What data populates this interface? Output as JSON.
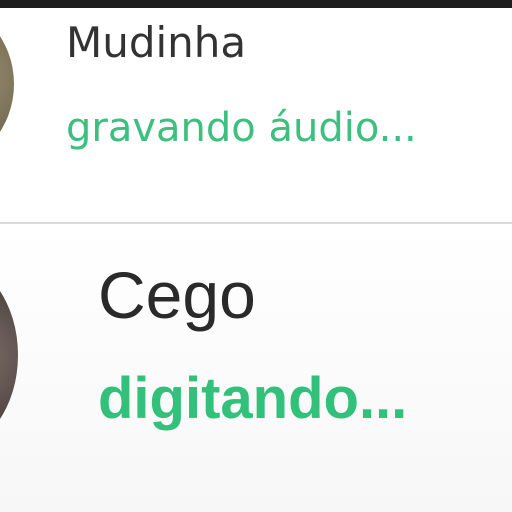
{
  "chats": [
    {
      "name": "Mudinha",
      "status": "gravando áudio..."
    },
    {
      "name": "Cego",
      "status": "digitando..."
    }
  ],
  "colors": {
    "status_green": "#32c07a",
    "name_text": "#2a2a2a",
    "divider": "#d9d9d9"
  }
}
